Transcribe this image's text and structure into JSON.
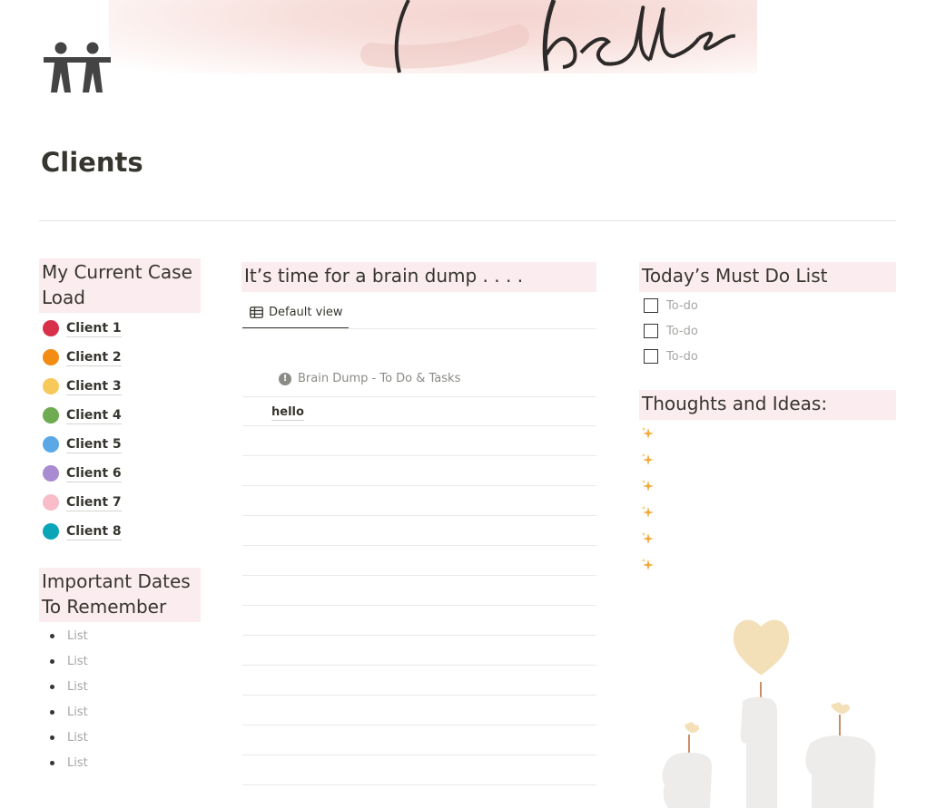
{
  "cover": {
    "script_text": "belle"
  },
  "page": {
    "title": "Clients",
    "icon": "people-icon"
  },
  "case_load": {
    "heading": "My Current Case Load",
    "heading_line1": "My Current Case",
    "heading_line2": "Load",
    "clients": [
      {
        "label": "Client 1",
        "color": "#d8304a"
      },
      {
        "label": "Client 2",
        "color": "#f28c12"
      },
      {
        "label": "Client 3",
        "color": "#f7c95a"
      },
      {
        "label": "Client 4",
        "color": "#6fab50"
      },
      {
        "label": "Client 5",
        "color": "#5aa8e6"
      },
      {
        "label": "Client 6",
        "color": "#a98bd1"
      },
      {
        "label": "Client 7",
        "color": "#f9bcc9"
      },
      {
        "label": "Client 8",
        "color": "#0aa6b8"
      }
    ]
  },
  "important_dates": {
    "heading_line1": "Important Dates",
    "heading_line2": "To Remember",
    "items": [
      "List",
      "List",
      "List",
      "List",
      "List",
      "List"
    ]
  },
  "brain_dump": {
    "heading": "It’s time for a brain dump . . . .",
    "view_tab": "Default view",
    "database_title": "Brain Dump - To Do & Tasks",
    "rows": [
      "hello",
      "",
      "",
      "",
      "",
      "",
      "",
      "",
      "",
      "",
      "",
      "",
      ""
    ]
  },
  "must_do": {
    "heading": "Today’s Must Do List",
    "todos": [
      "To-do",
      "To-do",
      "To-do"
    ]
  },
  "thoughts": {
    "heading": "Thoughts and Ideas:",
    "items_count": 6,
    "icon": "sparkles-icon"
  },
  "colors": {
    "heading_bg": "#fbecef",
    "text": "#37352f",
    "placeholder": "#a6a6a4"
  }
}
